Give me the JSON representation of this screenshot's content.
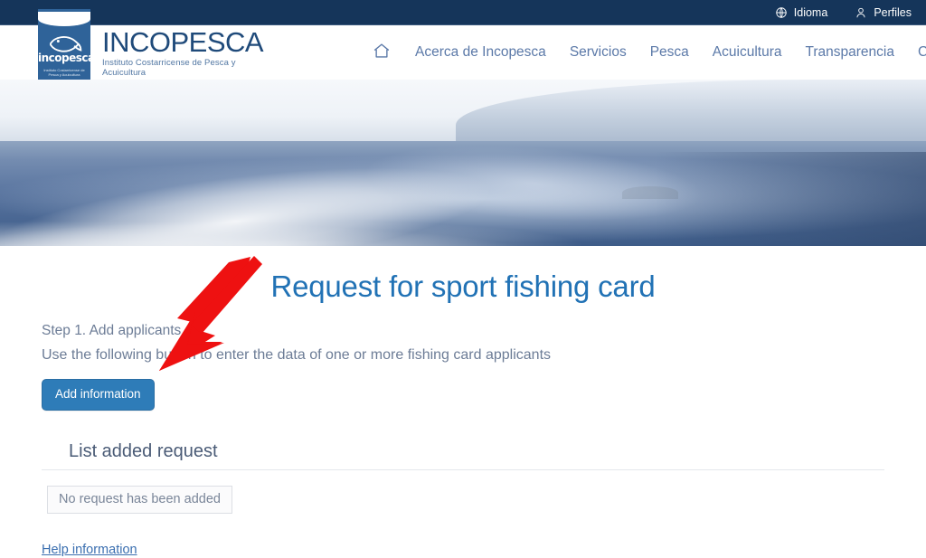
{
  "topbar": {
    "items": [
      {
        "label": "Idioma",
        "icon": "globe-icon"
      },
      {
        "label": "Perfiles",
        "icon": "user-icon"
      }
    ]
  },
  "header": {
    "logo": {
      "icon": "fish-logo-icon",
      "wordmark": "incopesca",
      "wordmark_sub": "Instituto Costarricense de Pesca y Acuicultura"
    },
    "brand_name": "INCOPESCA",
    "brand_tagline": "Instituto Costarricense de Pesca y Acuicultura",
    "nav": {
      "home_icon": "home-icon",
      "items": [
        {
          "label": "Acerca de Incopesca"
        },
        {
          "label": "Servicios"
        },
        {
          "label": "Pesca"
        },
        {
          "label": "Acuicultura"
        },
        {
          "label": "Transparencia"
        },
        {
          "label": "C"
        }
      ]
    }
  },
  "hero": {
    "alt": "ocean-boat-wake-banner"
  },
  "main": {
    "page_title": "Request for sport fishing card",
    "step_label": "Step 1. Add applicants",
    "intro_text": "Use the following button to enter the data of one or more fishing card applicants",
    "add_button_label": "Add information",
    "list_section_title": "List added request",
    "empty_message": "No request has been added",
    "help_link_label": "Help information"
  },
  "annotation": {
    "arrow": "red-arrow-pointing-to-add-information-button",
    "color": "#EE1111"
  },
  "colors": {
    "topbar_bg": "#15355A",
    "brand_blue": "#1F4A7A",
    "nav_text": "#5B79A8",
    "title_blue": "#2172B5",
    "button_blue": "#2E7CB8",
    "body_text": "#6C7C96",
    "link_blue": "#3B6FB0",
    "arrow_red": "#EE1111"
  }
}
